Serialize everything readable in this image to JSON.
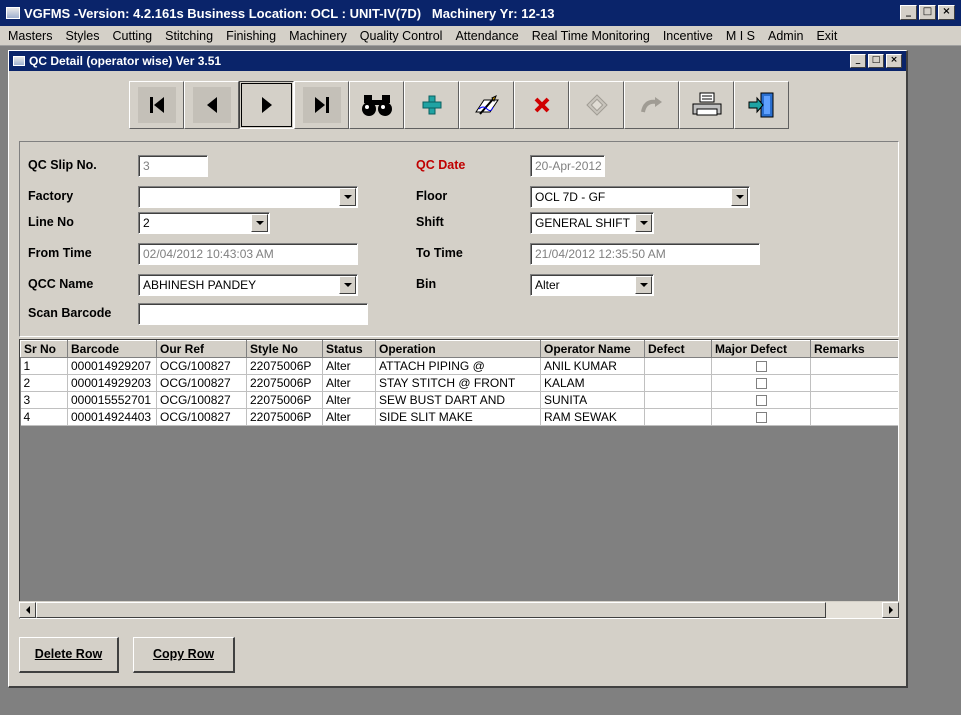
{
  "app": {
    "title": "VGFMS -Version: 4.2.161s Business Location: OCL : UNIT-IV(7D)   Machinery Yr: 12-13"
  },
  "menu": [
    "Masters",
    "Styles",
    "Cutting",
    "Stitching",
    "Finishing",
    "Machinery",
    "Quality Control",
    "Attendance",
    "Real Time Monitoring",
    "Incentive",
    "M I S",
    "Admin",
    "Exit"
  ],
  "window": {
    "title": "QC Detail (operator wise) Ver 3.51"
  },
  "toolbar": {
    "icons": [
      "first-record-icon",
      "previous-record-icon",
      "next-record-icon",
      "last-record-icon",
      "binoculars-search-icon",
      "add-icon",
      "edit-icon",
      "delete-icon",
      "save-icon",
      "undo-icon",
      "print-icon",
      "exit-icon"
    ]
  },
  "form": {
    "qc_slip_label": "QC Slip No.",
    "qc_slip_value": "3",
    "qc_date_label": "QC Date",
    "qc_date_value": "20-Apr-2012",
    "factory_label": "Factory",
    "factory_value": "",
    "floor_label": "Floor",
    "floor_value": "OCL 7D - GF",
    "line_label": "Line No",
    "line_value": "2",
    "shift_label": "Shift",
    "shift_value": "GENERAL SHIFT",
    "from_time_label": "From Time",
    "from_time_value": "02/04/2012 10:43:03 AM",
    "to_time_label": "To Time",
    "to_time_value": "21/04/2012 12:35:50 AM",
    "qcc_label": "QCC Name",
    "qcc_value": "ABHINESH PANDEY",
    "bin_label": "Bin",
    "bin_value": "Alter",
    "scan_label": "Scan Barcode",
    "scan_value": ""
  },
  "grid": {
    "columns": [
      "Sr No",
      "Barcode",
      "Our Ref",
      "Style No",
      "Status",
      "Operation",
      "Operator Name",
      "Defect",
      "Major Defect",
      "Remarks"
    ],
    "rows": [
      {
        "sr": "1",
        "barcode": "000014929207",
        "ref": "OCG/100827",
        "style": "22075006P",
        "status": "Alter",
        "operation": "ATTACH PIPING @",
        "operator": "ANIL KUMAR",
        "defect": "",
        "major": false,
        "remarks": ""
      },
      {
        "sr": "2",
        "barcode": "000014929203",
        "ref": "OCG/100827",
        "style": "22075006P",
        "status": "Alter",
        "operation": "STAY STITCH @ FRONT",
        "operator": "KALAM",
        "defect": "",
        "major": false,
        "remarks": ""
      },
      {
        "sr": "3",
        "barcode": "000015552701",
        "ref": "OCG/100827",
        "style": "22075006P",
        "status": "Alter",
        "operation": "SEW BUST DART AND",
        "operator": "SUNITA",
        "defect": "",
        "major": false,
        "remarks": ""
      },
      {
        "sr": "4",
        "barcode": "000014924403",
        "ref": "OCG/100827",
        "style": "22075006P",
        "status": "Alter",
        "operation": "SIDE SLIT MAKE",
        "operator": "RAM SEWAK",
        "defect": "",
        "major": false,
        "remarks": ""
      }
    ]
  },
  "buttons": {
    "delete_row": "Delete Row",
    "copy_row": "Copy Row"
  },
  "colors": {
    "title_bar": "#0a246a",
    "face": "#d4d0c8",
    "qc_date_label": "#c00000"
  }
}
